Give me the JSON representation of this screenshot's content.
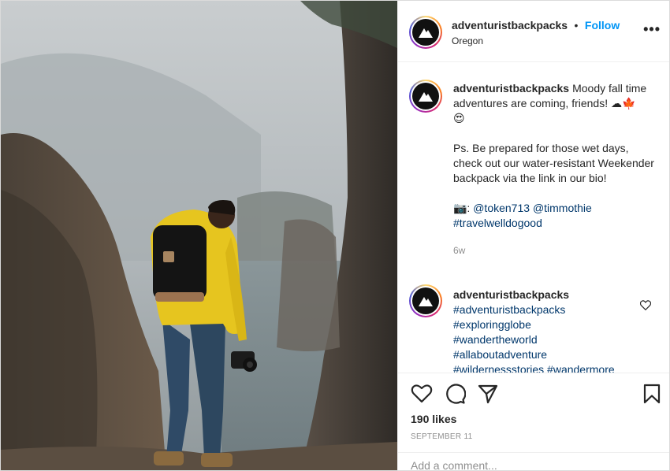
{
  "post": {
    "username": "adventuristbackpacks",
    "follow_label": "Follow",
    "separator": "•",
    "location": "Oregon",
    "more_label": "•••"
  },
  "caption": {
    "username": "adventuristbackpacks",
    "line1": "Moody fall time adventures are coming, friends! ☁🍁",
    "line1b": "😍",
    "para2": "Ps. Be prepared for those wet days, check out our water-resistant Weekender backpack via the link in our bio!",
    "camera": "📷:",
    "mention1": "@token713",
    "mention2": "@timmothie",
    "hashtag": "#travelwelldogood",
    "time": "6w"
  },
  "comment2": {
    "username": "adventuristbackpacks",
    "tags": [
      "#adventuristbackpacks",
      "#exploringglobe",
      "#wandertheworld",
      "#allaboutadventure",
      "#wildernessstories #wandermore"
    ]
  },
  "actions": {
    "icons": [
      "heart-icon",
      "comment-icon",
      "share-icon",
      "bookmark-icon"
    ],
    "likes": "190 likes",
    "date": "SEPTEMBER 11",
    "add_comment": "Add a comment..."
  },
  "colors": {
    "follow": "#0095f6",
    "link": "#00376b",
    "muted": "#8e8e8e",
    "jacket": "#e6c51f"
  }
}
